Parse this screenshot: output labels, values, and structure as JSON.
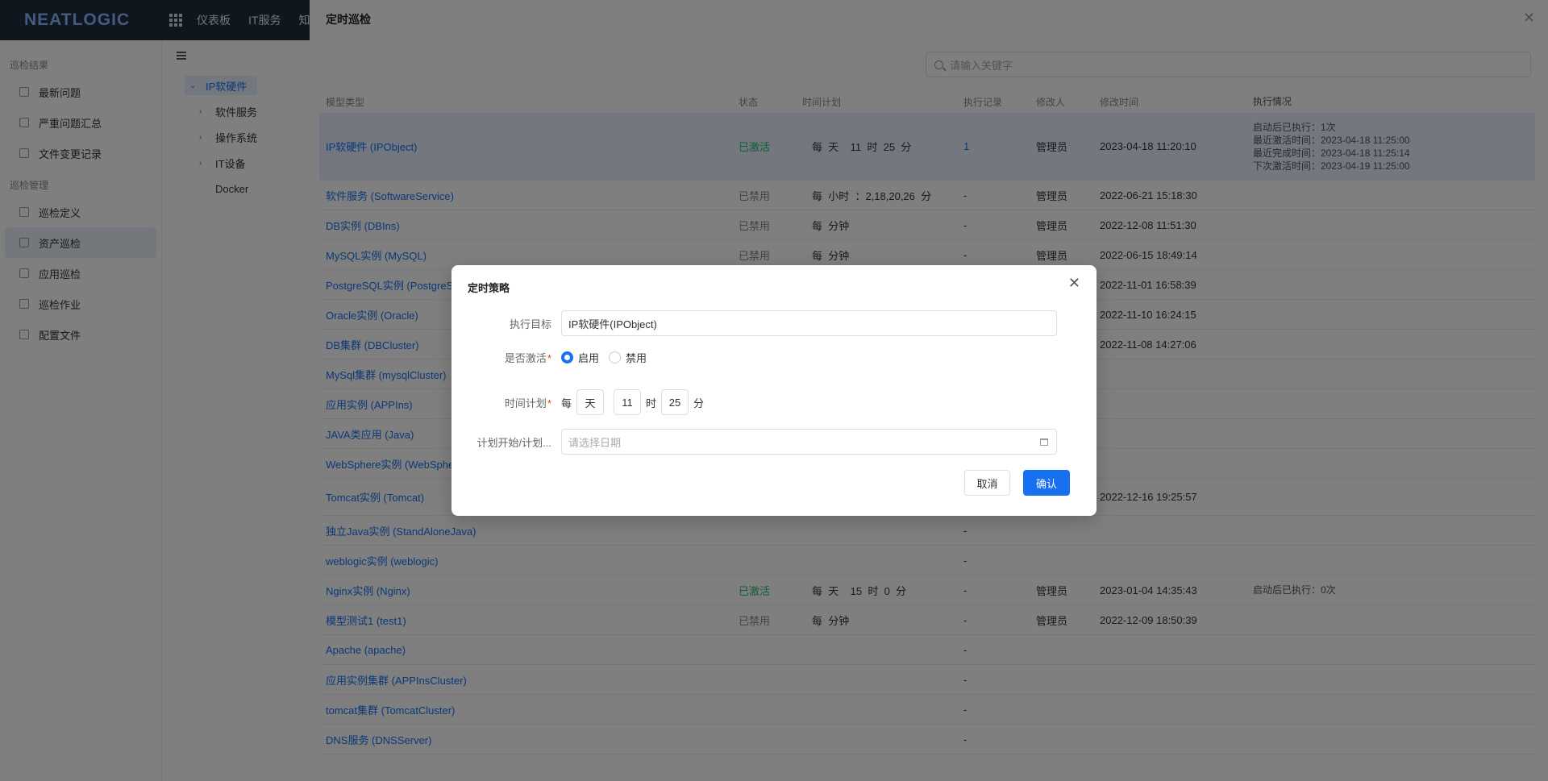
{
  "topbar": {
    "logo": "NEATLOGIC",
    "nav": [
      "仪表板",
      "IT服务",
      "知"
    ]
  },
  "sidebar": {
    "groups": [
      {
        "title": "巡检结果",
        "items": [
          "最新问题",
          "严重问题汇总",
          "文件变更记录"
        ]
      },
      {
        "title": "巡检管理",
        "items": [
          "巡检定义",
          "资产巡检",
          "应用巡检",
          "巡检作业",
          "配置文件"
        ]
      }
    ]
  },
  "tree": {
    "root": "IP软硬件",
    "children": [
      "软件服务",
      "操作系统",
      "IT设备",
      "Docker"
    ]
  },
  "drawer": {
    "title": "定时巡检",
    "search_placeholder": "请输入关键字",
    "columns": [
      "模型类型",
      "状态",
      "时间计划",
      "执行记录",
      "修改人",
      "修改时间",
      "执行情况"
    ],
    "rows": [
      {
        "model": "IP软硬件 (IPObject)",
        "status": "已激活",
        "schedule": "每  天    11  时  25  分",
        "records": "1",
        "editor": "管理员",
        "time": "2023-04-18 11:20:10",
        "exec": [
          "启动后已执行：1次",
          "最近激活时间：2023-04-18 11:25:00",
          "最近完成时间：2023-04-18 11:25:14",
          "下次激活时间：2023-04-19 11:25:00"
        ]
      },
      {
        "model": "软件服务 (SoftwareService)",
        "status": "已禁用",
        "schedule": "每  小时  ：2,18,20,26  分",
        "records": "-",
        "editor": "管理员",
        "time": "2022-06-21 15:18:30",
        "exec": []
      },
      {
        "model": "DB实例 (DBIns)",
        "status": "已禁用",
        "schedule": "每  分钟",
        "records": "-",
        "editor": "管理员",
        "time": "2022-12-08 11:51:30",
        "exec": []
      },
      {
        "model": "MySQL实例 (MySQL)",
        "status": "已禁用",
        "schedule": "每  分钟",
        "records": "-",
        "editor": "管理员",
        "time": "2022-06-15 18:49:14",
        "exec": []
      },
      {
        "model": "PostgreSQL实例 (PostgreSQL)",
        "status": "",
        "schedule": "",
        "records": "",
        "editor": "",
        "time": "2022-11-01 16:58:39",
        "exec": []
      },
      {
        "model": "Oracle实例 (Oracle)",
        "status": "",
        "schedule": "",
        "records": "",
        "editor": "",
        "time": "2022-11-10 16:24:15",
        "exec": []
      },
      {
        "model": "DB集群 (DBCluster)",
        "status": "",
        "schedule": "",
        "records": "",
        "editor": "",
        "time": "2022-11-08 14:27:06",
        "exec": []
      },
      {
        "model": "MySql集群 (mysqlCluster)",
        "status": "",
        "schedule": "",
        "records": "",
        "editor": "",
        "time": "",
        "exec": []
      },
      {
        "model": "应用实例 (APPIns)",
        "status": "",
        "schedule": "",
        "records": "",
        "editor": "",
        "time": "",
        "exec": []
      },
      {
        "model": "JAVA类应用 (Java)",
        "status": "",
        "schedule": "",
        "records": "",
        "editor": "",
        "time": "",
        "exec": []
      },
      {
        "model": "WebSphere实例 (WebSphere)",
        "status": "",
        "schedule": "",
        "records": "",
        "editor": "",
        "time": "",
        "exec": []
      },
      {
        "model": "Tomcat实例 (Tomcat)",
        "status": "",
        "schedule": "",
        "records": "",
        "editor": "",
        "time": "2022-12-16 19:25:57",
        "exec": []
      },
      {
        "model": "独立Java实例 (StandAloneJava)",
        "status": "",
        "schedule": "",
        "records": "-",
        "editor": "",
        "time": "",
        "exec": []
      },
      {
        "model": "weblogic实例 (weblogic)",
        "status": "",
        "schedule": "",
        "records": "-",
        "editor": "",
        "time": "",
        "exec": []
      },
      {
        "model": "Nginx实例 (Nginx)",
        "status": "已激活",
        "schedule": "每  天    15  时  0  分",
        "records": "-",
        "editor": "管理员",
        "time": "2023-01-04 14:35:43",
        "exec": [
          "启动后已执行：0次"
        ]
      },
      {
        "model": "模型测试1 (test1)",
        "status": "已禁用",
        "schedule": "每  分钟",
        "records": "-",
        "editor": "管理员",
        "time": "2022-12-09 18:50:39",
        "exec": []
      },
      {
        "model": "Apache (apache)",
        "status": "",
        "schedule": "",
        "records": "-",
        "editor": "",
        "time": "",
        "exec": []
      },
      {
        "model": "应用实例集群 (APPInsCluster)",
        "status": "",
        "schedule": "",
        "records": "-",
        "editor": "",
        "time": "",
        "exec": []
      },
      {
        "model": "tomcat集群 (TomcatCluster)",
        "status": "",
        "schedule": "",
        "records": "-",
        "editor": "",
        "time": "",
        "exec": []
      },
      {
        "model": "DNS服务 (DNSServer)",
        "status": "",
        "schedule": "",
        "records": "-",
        "editor": "",
        "time": "",
        "exec": []
      }
    ]
  },
  "modal": {
    "title": "定时策略",
    "target_label": "执行目标",
    "target_value": "IP软硬件(IPObject)",
    "active_label": "是否激活",
    "enable_label": "启用",
    "disable_label": "禁用",
    "schedule_label": "时间计划",
    "every": "每",
    "unit": "天",
    "hour": "11",
    "hour_unit": "时",
    "minute": "25",
    "minute_unit": "分",
    "range_label": "计划开始/计划...",
    "date_placeholder": "请选择日期",
    "cancel": "取消",
    "confirm": "确认"
  }
}
